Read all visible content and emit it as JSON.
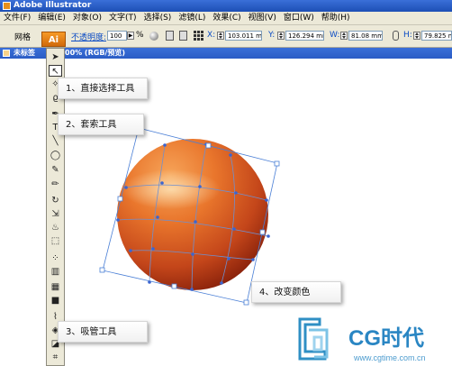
{
  "window": {
    "title": "Adobe Illustrator"
  },
  "menu": [
    "文件(F)",
    "编辑(E)",
    "对象(O)",
    "文字(T)",
    "选择(S)",
    "滤镜(L)",
    "效果(C)",
    "视图(V)",
    "窗口(W)",
    "帮助(H)"
  ],
  "control_bar": {
    "grid_label": "网格",
    "app_logo": "Ai",
    "opacity_label": "不透明度:",
    "opacity_value": "100",
    "opacity_unit": "%",
    "x_label": "X:",
    "x_value": "103.011 mm",
    "y_label": "Y:",
    "y_value": "126.294 mm",
    "w_label": "W:",
    "w_value": "81.08 mm",
    "h_label": "H:",
    "h_value": "79.825 mm"
  },
  "document": {
    "tab_title_left": "未标签",
    "tab_title_right": "00% (RGB/预览)"
  },
  "callouts": {
    "c1": "1、直接选择工具",
    "c2": "2、套索工具",
    "c3": "3、吸管工具",
    "c4": "4、改变颜色"
  },
  "colors": {
    "accent": "#e8901c",
    "title_blue": "#2a5cc5",
    "sphere_light": "#f5a25a",
    "sphere_dark": "#8c1e08"
  },
  "watermark": {
    "brand": "CG时代",
    "url": "www.cgtime.com.cn"
  },
  "tools": [
    "selection-arrow-icon",
    "direct-selection-icon",
    "magic-wand-icon",
    "lasso-icon",
    "pen-icon",
    "type-icon",
    "line-icon",
    "ellipse-icon",
    "paintbrush-icon",
    "pencil-icon",
    "rotate-icon",
    "scale-icon",
    "warp-icon",
    "free-transform-icon",
    "symbol-sprayer-icon",
    "column-graph-icon",
    "mesh-icon",
    "gradient-icon",
    "eyedropper-icon",
    "blend-icon",
    "live-paint-icon",
    "crop-icon"
  ]
}
